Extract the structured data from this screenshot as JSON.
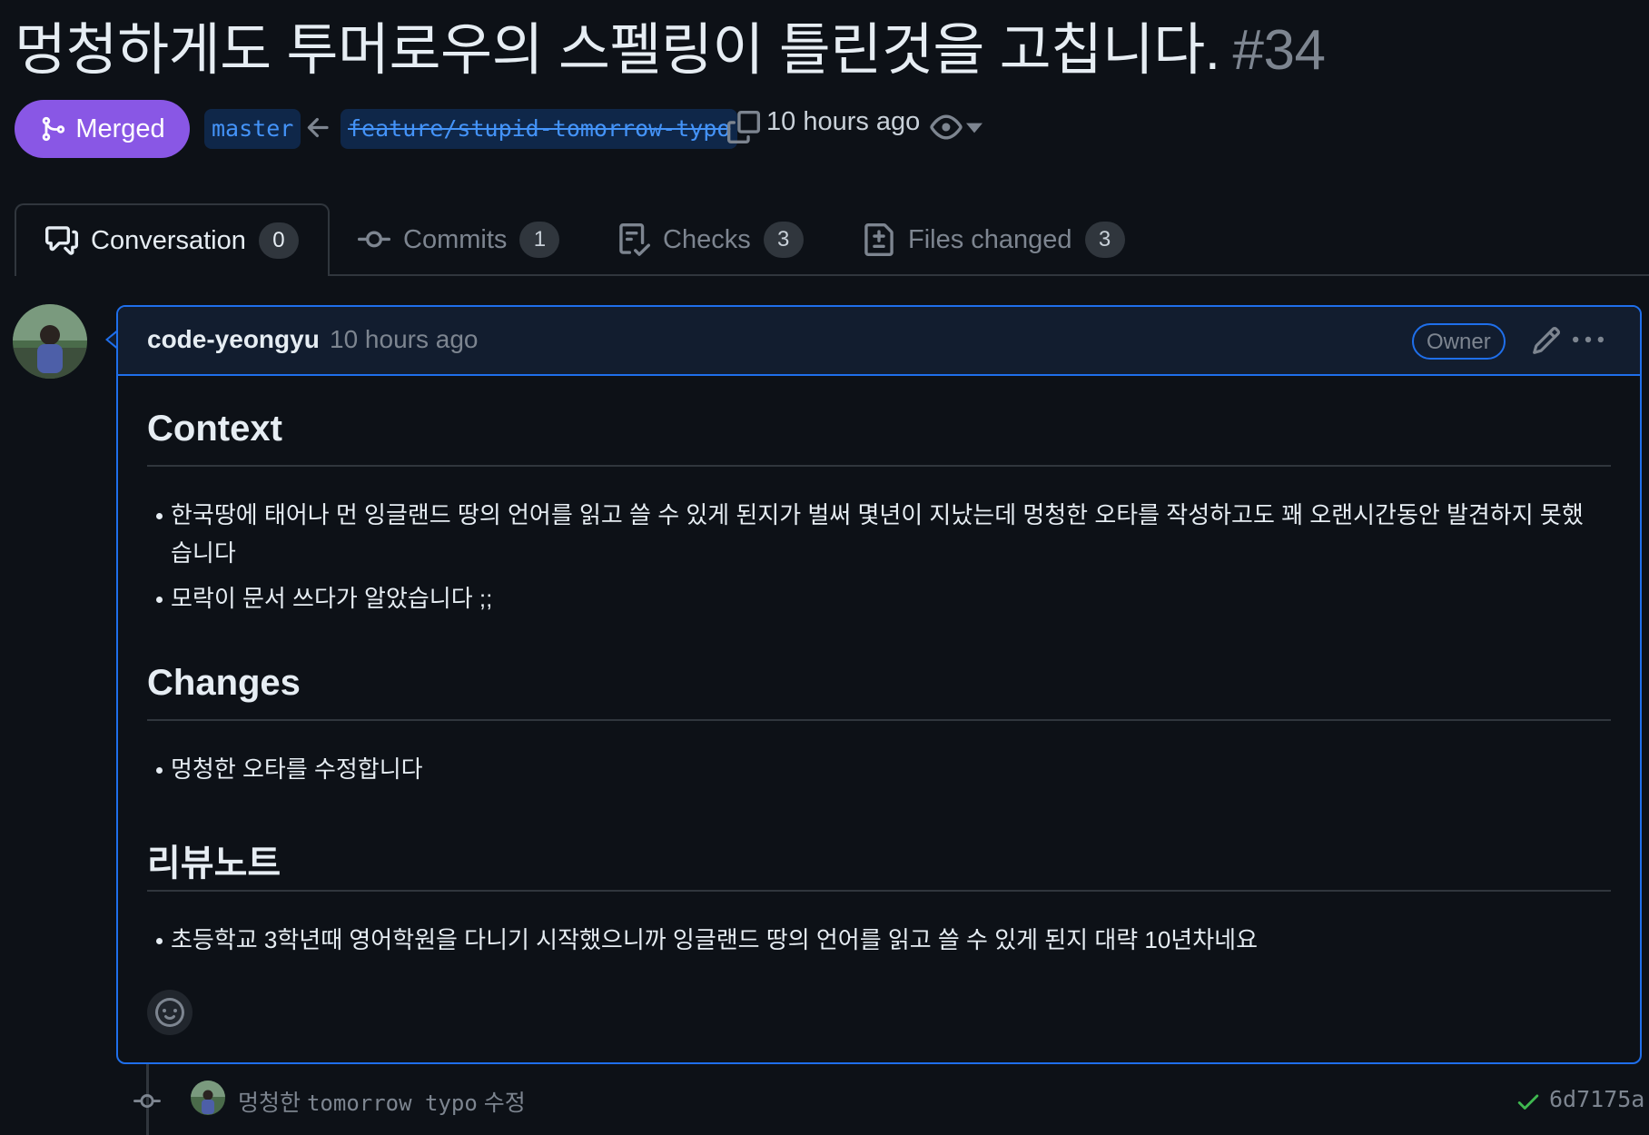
{
  "pr": {
    "title": "멍청하게도 투머로우의 스펠링이 틀린것을 고칩니다.",
    "number": "#34",
    "state_label": "Merged",
    "base_branch": "master",
    "head_branch": "feature/stupid-tomorrow-typo",
    "time": "10 hours ago"
  },
  "tabs": [
    {
      "label": "Conversation",
      "count": "0",
      "icon": "conversation-icon",
      "active": true
    },
    {
      "label": "Commits",
      "count": "1",
      "icon": "commit-icon"
    },
    {
      "label": "Checks",
      "count": "3",
      "icon": "checks-icon"
    },
    {
      "label": "Files changed",
      "count": "3",
      "icon": "file-diff-icon"
    }
  ],
  "comment": {
    "author": "code-yeongyu",
    "time": "10 hours ago",
    "role_badge": "Owner",
    "sections": [
      {
        "heading": "Context",
        "items": [
          "한국땅에 태어나 먼 잉글랜드 땅의 언어를 읽고 쓸 수 있게 된지가 벌써 몇년이 지났는데 멍청한 오타를 작성하고도 꽤 오랜시간동안 발견하지 못했습니다",
          "모락이 문서 쓰다가 알았습니다 ;;"
        ]
      },
      {
        "heading": "Changes",
        "items": [
          "멍청한 오타를 수정합니다"
        ]
      },
      {
        "heading": "리뷰노트",
        "items": [
          "초등학교 3학년때 영어학원을 다니기 시작했으니까 잉글랜드 땅의 언어를 읽고 쓸 수 있게 된지 대략 10년차네요"
        ]
      }
    ]
  },
  "commit": {
    "message_prefix": "멍청한",
    "message_code": "tomorrow typo",
    "message_suffix": "수정",
    "sha": "6d7175a",
    "status": "success"
  },
  "colors": {
    "merged": "#8957e5",
    "accent": "#1f6feb",
    "link": "#4493f8",
    "success": "#3fb950",
    "background": "#0d1117"
  }
}
